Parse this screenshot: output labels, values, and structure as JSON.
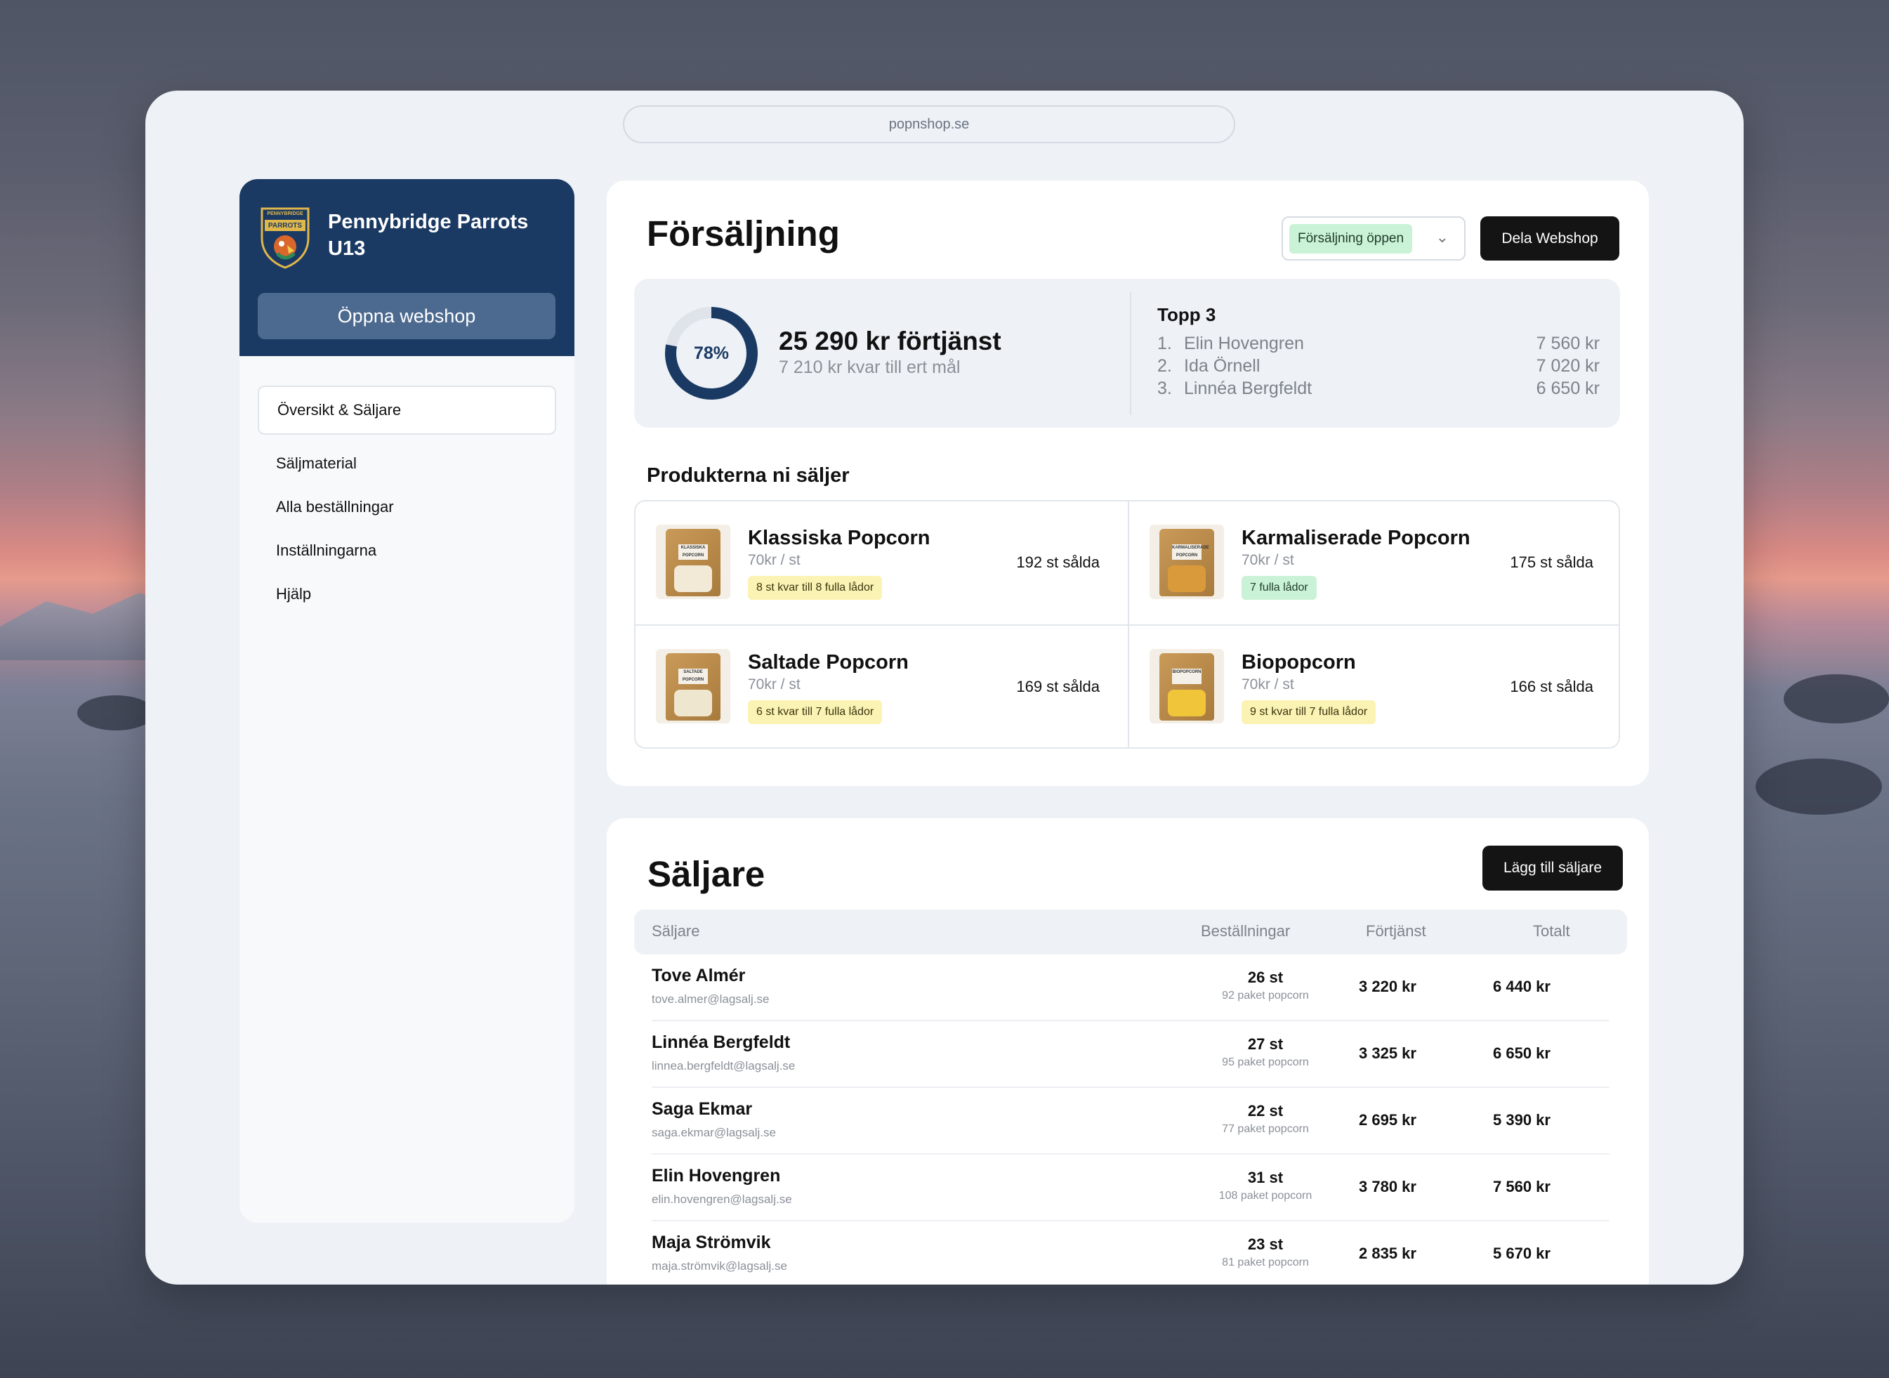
{
  "browser": {
    "url": "popnshop.se"
  },
  "sidebar": {
    "team_name": "Pennybridge Parrots U13",
    "badge_text_top": "PENNYBRIDGE",
    "badge_text_main": "PARROTS",
    "open_shop_label": "Öppna webshop",
    "nav": [
      {
        "label": "Översikt & Säljare",
        "active": true
      },
      {
        "label": "Säljmaterial"
      },
      {
        "label": "Alla beställningar"
      },
      {
        "label": "Inställningarna"
      },
      {
        "label": "Hjälp"
      }
    ]
  },
  "sales": {
    "title": "Försäljning",
    "status_label": "Försäljning öppen",
    "share_label": "Dela Webshop",
    "progress_percent": 78,
    "progress_label": "78%",
    "profit": "25 290 kr förtjänst",
    "remaining": "7 210 kr kvar till ert mål",
    "top3_title": "Topp 3",
    "top3": [
      {
        "rank": "1.",
        "name": "Elin Hovengren",
        "amount": "7 560 kr"
      },
      {
        "rank": "2.",
        "name": "Ida Örnell",
        "amount": "7 020 kr"
      },
      {
        "rank": "3.",
        "name": "Linnéa Bergfeldt",
        "amount": "6 650 kr"
      }
    ],
    "products_title": "Produkterna ni säljer",
    "products": [
      {
        "name": "Klassiska Popcorn",
        "price": "70kr / st",
        "tag": "8 st kvar till 8 fulla lådor",
        "tag_color": "yellow",
        "sold": "192 st sålda",
        "bag_label": "KLASSISKA POPCORN",
        "pop_color": "#f2ead6"
      },
      {
        "name": "Karmaliserade Popcorn",
        "price": "70kr / st",
        "tag": "7 fulla lådor",
        "tag_color": "green",
        "sold": "175 st sålda",
        "bag_label": "KARMALISERADE POPCORN",
        "pop_color": "#d99a3c"
      },
      {
        "name": "Saltade Popcorn",
        "price": "70kr / st",
        "tag": "6 st kvar till 7 fulla lådor",
        "tag_color": "yellow",
        "sold": "169 st sålda",
        "bag_label": "SALTADE POPCORN",
        "pop_color": "#efe6cf"
      },
      {
        "name": "Biopopcorn",
        "price": "70kr / st",
        "tag": "9 st kvar till 7 fulla lådor",
        "tag_color": "yellow",
        "sold": "166 st sålda",
        "bag_label": "BIOPOPCORN",
        "pop_color": "#f0c53a"
      }
    ]
  },
  "sellers": {
    "title": "Säljare",
    "add_label": "Lägg till säljare",
    "columns": [
      "Säljare",
      "Beställningar",
      "Förtjänst",
      "Totalt"
    ],
    "rows": [
      {
        "name": "Tove Almér",
        "email": "tove.almer@lagsalj.se",
        "orders": "26 st",
        "packages": "92 paket popcorn",
        "profit": "3 220 kr",
        "total": "6 440 kr"
      },
      {
        "name": "Linnéa Bergfeldt",
        "email": "linnea.bergfeldt@lagsalj.se",
        "orders": "27 st",
        "packages": "95 paket popcorn",
        "profit": "3 325 kr",
        "total": "6 650 kr"
      },
      {
        "name": "Saga Ekmar",
        "email": "saga.ekmar@lagsalj.se",
        "orders": "22 st",
        "packages": "77 paket popcorn",
        "profit": "2 695 kr",
        "total": "5 390 kr"
      },
      {
        "name": "Elin Hovengren",
        "email": "elin.hovengren@lagsalj.se",
        "orders": "31 st",
        "packages": "108 paket popcorn",
        "profit": "3 780 kr",
        "total": "7 560 kr"
      },
      {
        "name": "Maja Strömvik",
        "email": "maja.strömvik@lagsalj.se",
        "orders": "23 st",
        "packages": "81 paket popcorn",
        "profit": "2 835 kr",
        "total": "5 670 kr"
      }
    ]
  }
}
